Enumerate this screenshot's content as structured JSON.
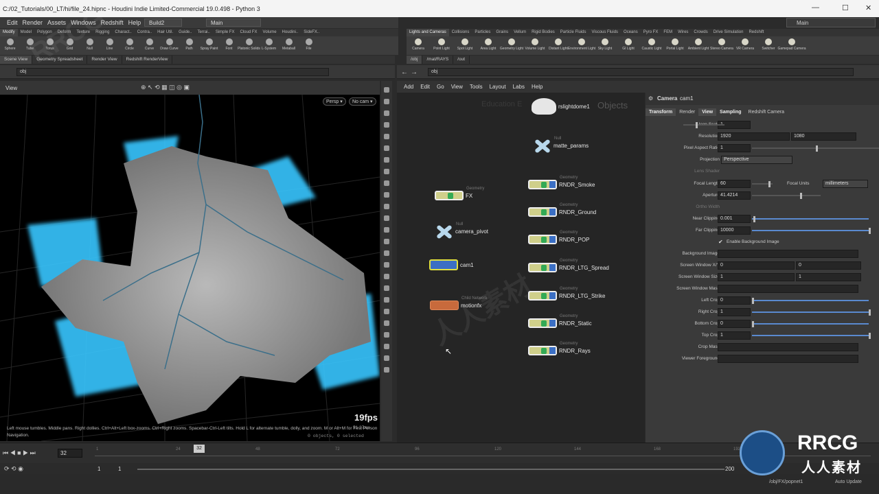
{
  "window": {
    "title": "C:/02_Tutorials/00_LT/hi/file_24.hipnc - Houdini Indie Limited-Commercial 19.0.498 - Python 3",
    "min": "—",
    "max": "☐",
    "close": "✕"
  },
  "menu": [
    "Edit",
    "Render",
    "Assets",
    "Windows",
    "Redshift",
    "Help"
  ],
  "desktop": {
    "build": "Build2",
    "main_left": "Main",
    "main_right": "Main"
  },
  "left_shelf_tabs": [
    "Modify",
    "Model",
    "Polygon",
    "Deform",
    "Texture",
    "Rigging",
    "Charact..",
    "Contra..",
    "Hair Util.",
    "Guide..",
    "Terrai..",
    "Simple FX",
    "Cloud FX",
    "Volume",
    "Houdini..",
    "SideFX.."
  ],
  "left_tools": [
    "Sphere",
    "Tube",
    "Torus",
    "Grid",
    "Null",
    "Line",
    "Circle",
    "Curve",
    "Draw Curve",
    "Path",
    "Spray Paint",
    "Font",
    "Platonic Solids",
    "L-System",
    "Metaball",
    "File"
  ],
  "right_shelf_tabs": [
    "Lights and Cameras",
    "Collisions",
    "Particles",
    "Grains",
    "Vellum",
    "Rigid Bodies",
    "Particle Fluids",
    "Viscous Fluids",
    "Oceans",
    "Pyro FX",
    "FEM",
    "Wires",
    "Crowds",
    "Drive Simulation",
    "Redshift"
  ],
  "right_tools": [
    "Camera",
    "Point Light",
    "Spot Light",
    "Area Light",
    "Geometry Light",
    "Volume Light",
    "Distant Light",
    "Environment Light",
    "Sky Light",
    "GI Light",
    "Caustic Light",
    "Portal Light",
    "Ambient Light",
    "Stereo Camera",
    "VR Camera",
    "Switcher",
    "Gamepad Camera"
  ],
  "left_panes": [
    "Scene View",
    "Geometry Spreadsheet",
    "Render View",
    "Redshift RenderView"
  ],
  "right_panes": [
    "/obj",
    "/mat/RAYS",
    "/out"
  ],
  "left_path": "obj",
  "right_path": "obj",
  "viewport": {
    "label": "View",
    "persp": "Persp ▾",
    "cam": "No cam ▾",
    "fps": "19fps",
    "help": "Left mouse tumbles. Middle pans. Right dollies. Ctrl+Alt+Left box-zooms. Ctrl+Right zooms. Spacebar-Ctrl-Left tilts. Hold L for alternate tumble, dolly, and zoom. M or Alt+M for First Person Navigation.",
    "selection": "0 objects, 0 selected",
    "sub": "51.37ms"
  },
  "network": {
    "menu": [
      "Add",
      "Edit",
      "Go",
      "View",
      "Tools",
      "Layout",
      "Labs",
      "Help"
    ],
    "context_left": "Education E",
    "context_right": "Objects",
    "nodes": [
      {
        "name": "rslightdome1",
        "type": ""
      },
      {
        "name": "matte_params",
        "type": "Null"
      },
      {
        "name": "FX",
        "type": "Geometry"
      },
      {
        "name": "RNDR_Smoke",
        "type": "Geometry"
      },
      {
        "name": "RNDR_Ground",
        "type": "Geometry"
      },
      {
        "name": "camera_pivot",
        "type": "Null"
      },
      {
        "name": "RNDR_POP",
        "type": "Geometry"
      },
      {
        "name": "cam1",
        "type": ""
      },
      {
        "name": "RNDR_LTG_Spread",
        "type": "Geometry"
      },
      {
        "name": "motionfx",
        "type": "Child Network"
      },
      {
        "name": "RNDR_LTG_Strike",
        "type": "Geometry"
      },
      {
        "name": "RNDR_Static",
        "type": "Geometry"
      },
      {
        "name": "RNDR_Rays",
        "type": "Geometry"
      }
    ]
  },
  "params": {
    "node_type": "Camera",
    "node_name": "cam1",
    "tabs": [
      "Transform",
      "Render",
      "View",
      "Sampling",
      "Redshift Camera"
    ],
    "rows": [
      {
        "label": "Icon Scale",
        "v1": "1"
      },
      {
        "label": "Resolution",
        "v1": "1920",
        "v2": "1080"
      },
      {
        "label": "Pixel Aspect Ratio",
        "v1": "1"
      },
      {
        "label": "Projection",
        "v1": "Perspective"
      },
      {
        "label": "Lens Shader",
        "v1": ""
      },
      {
        "label": "Focal Length",
        "v1": "60",
        "unit_label": "Focal Units",
        "unit": "millimeters"
      },
      {
        "label": "Aperture",
        "v1": "41.4214"
      },
      {
        "label": "Ortho Width",
        "v1": ""
      },
      {
        "label": "Near Clipping",
        "v1": "0.001"
      },
      {
        "label": "Far Clipping",
        "v1": "10000"
      },
      {
        "label": "Enable Background Image",
        "v1": ""
      },
      {
        "label": "Background Image",
        "v1": ""
      },
      {
        "label": "Screen Window X/Y",
        "v1": "0",
        "v2": "0"
      },
      {
        "label": "Screen Window Size",
        "v1": "1",
        "v2": "1"
      },
      {
        "label": "Screen Window Mask",
        "v1": ""
      },
      {
        "label": "Left Crop",
        "v1": "0"
      },
      {
        "label": "Right Crop",
        "v1": "1"
      },
      {
        "label": "Bottom Crop",
        "v1": "0"
      },
      {
        "label": "Top Crop",
        "v1": "1"
      },
      {
        "label": "Crop Mask",
        "v1": ""
      },
      {
        "label": "Viewer Foreground",
        "v1": ""
      }
    ]
  },
  "timeline": {
    "current_frame": "32",
    "marker": "32",
    "ticks": [
      "1",
      "24",
      "48",
      "72",
      "96",
      "120",
      "144",
      "168",
      "192"
    ],
    "start": "1",
    "start2": "1",
    "end": "200"
  },
  "status": {
    "path": "/obj/FX/popnet1",
    "update": "Auto Update"
  },
  "watermark": {
    "text1": "RRCG",
    "text2": "人人素材",
    "logo_big": "RRCG",
    "logo_small": "人人素材"
  }
}
